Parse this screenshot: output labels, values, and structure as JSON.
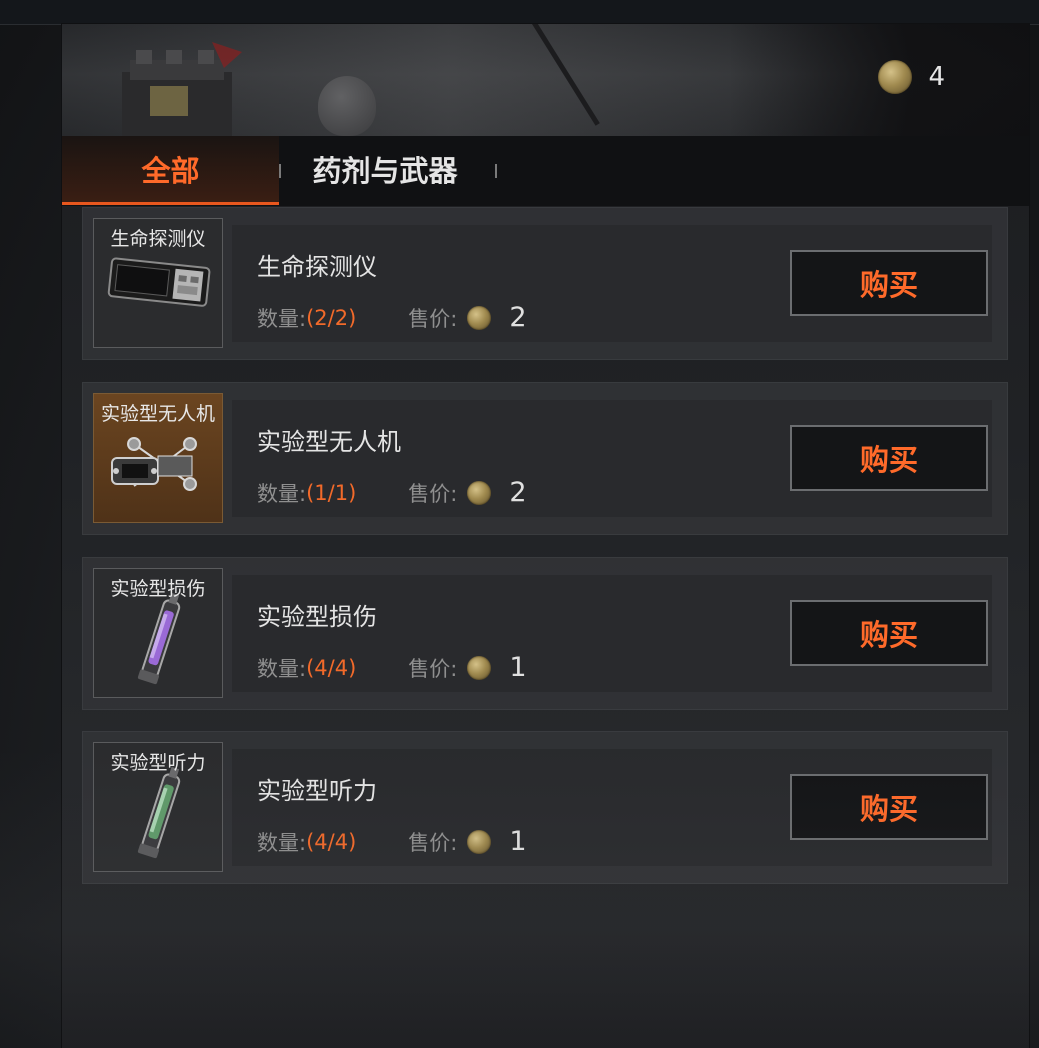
{
  "currency": {
    "icon": "coin-icon",
    "count": "4"
  },
  "tabs": [
    {
      "label": "全部",
      "active": true
    },
    {
      "label": "药剂与武器",
      "active": false
    }
  ],
  "qty_label": "数量:",
  "price_label": "售价:",
  "buy_label": "购买",
  "items": [
    {
      "thumb_label": "生命探测仪",
      "name": "生命探测仪",
      "qty": "(2/2)",
      "price": "2",
      "icon": "life-detector-icon",
      "rarity_color": "#2b2c2e"
    },
    {
      "thumb_label": "实验型无人机",
      "name": "实验型无人机",
      "qty": "(1/1)",
      "price": "2",
      "icon": "drone-icon",
      "rarity_color": "#6b4520"
    },
    {
      "thumb_label": "实验型损伤",
      "name": "实验型损伤",
      "qty": "(4/4)",
      "price": "1",
      "icon": "purple-syringe-icon",
      "rarity_color": "#2b2c2e"
    },
    {
      "thumb_label": "实验型听力",
      "name": "实验型听力",
      "qty": "(4/4)",
      "price": "1",
      "icon": "green-syringe-icon",
      "rarity_color": "#2b2c2e"
    }
  ],
  "colors": {
    "accent": "#f26a2a",
    "active_tab_border": "#e8571e"
  }
}
